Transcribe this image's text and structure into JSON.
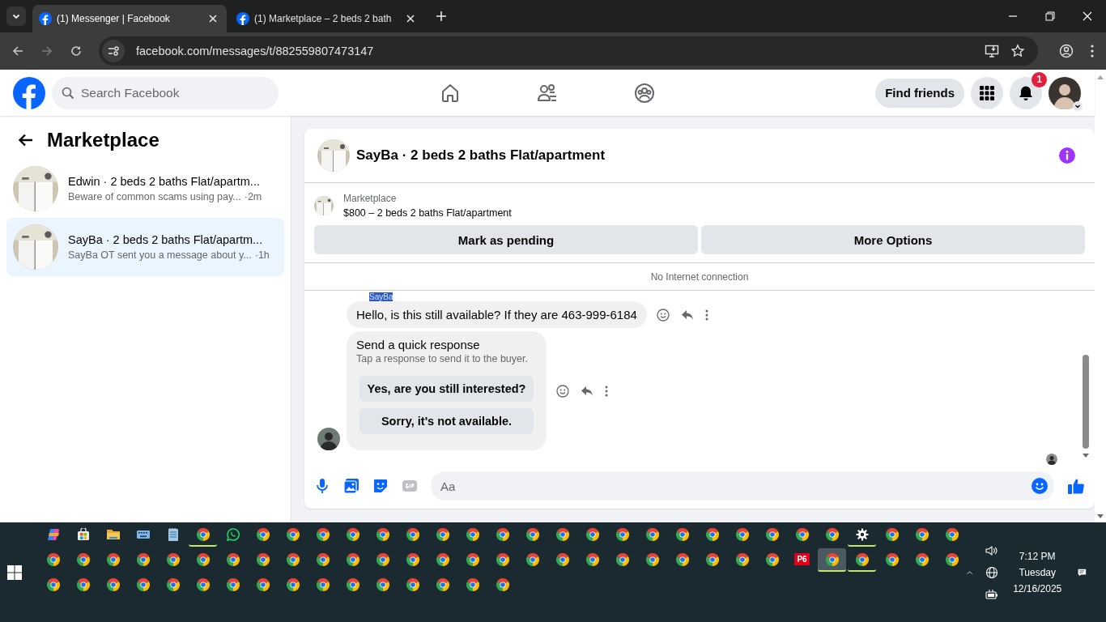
{
  "browser": {
    "tabs": [
      {
        "title": "(1) Messenger | Facebook",
        "selected": true
      },
      {
        "title": "(1) Marketplace – 2 beds 2 bath",
        "selected": false
      }
    ],
    "url": "facebook.com/messages/t/882559807473147"
  },
  "header": {
    "search": {
      "placeholder": "Search Facebook"
    },
    "find_friends": "Find friends",
    "notification_badge": "1"
  },
  "sidebar": {
    "title": "Marketplace",
    "conversations": [
      {
        "title": "Edwin · 2 beds 2 baths Flat/apartm...",
        "preview": "Beware of common scams using pay...",
        "time": "·2m",
        "selected": false
      },
      {
        "title": "SayBa · 2 beds 2 baths Flat/apartm...",
        "preview": "SayBa OT sent you a message about y...",
        "time": "·1h",
        "selected": true
      }
    ]
  },
  "chat": {
    "title": "SayBa · 2 beds 2 baths Flat/apartment",
    "listing": {
      "source": "Marketplace",
      "title": "$800 – 2 beds 2 baths Flat/apartment"
    },
    "actions": [
      "Mark as pending",
      "More Options"
    ],
    "status": "No Internet connection",
    "sender": "SayBa",
    "message": "Hello, is this still available? If they are 463-999-6184",
    "quick_response": {
      "title": "Send a quick response",
      "subtitle": "Tap a response to send it to the buyer.",
      "options": [
        "Yes, are you still interested?",
        "Sorry, it's not available."
      ]
    },
    "composer": {
      "placeholder": "Aa"
    }
  },
  "taskbar": {
    "rows": [
      [
        {
          "kind": "copilot",
          "running": false,
          "selected": false
        },
        {
          "kind": "store",
          "running": false,
          "selected": false
        },
        {
          "kind": "folder",
          "running": false,
          "selected": false
        },
        {
          "kind": "keyboard",
          "running": false,
          "selected": false
        },
        {
          "kind": "notepad",
          "running": false,
          "selected": false
        },
        {
          "kind": "chrome",
          "running": true,
          "selected": false
        },
        {
          "kind": "whatsapp",
          "running": false,
          "selected": false
        },
        {
          "kind": "chrome",
          "running": false,
          "selected": false
        },
        {
          "kind": "chrome",
          "running": false,
          "selected": false
        },
        {
          "kind": "chrome",
          "running": false,
          "selected": false
        },
        {
          "kind": "chrome",
          "running": false,
          "selected": false
        },
        {
          "kind": "chrome",
          "running": false,
          "selected": false
        },
        {
          "kind": "chrome",
          "running": false,
          "selected": false
        },
        {
          "kind": "chrome",
          "running": false,
          "selected": false
        },
        {
          "kind": "chrome",
          "running": false,
          "selected": false
        },
        {
          "kind": "chrome",
          "running": false,
          "selected": false
        },
        {
          "kind": "chrome",
          "running": false,
          "selected": false
        },
        {
          "kind": "chrome",
          "running": false,
          "selected": false
        },
        {
          "kind": "chrome",
          "running": false,
          "selected": false
        },
        {
          "kind": "chrome",
          "running": false,
          "selected": false
        },
        {
          "kind": "chrome",
          "running": false,
          "selected": false
        },
        {
          "kind": "chrome",
          "running": false,
          "selected": false
        },
        {
          "kind": "chrome",
          "running": false,
          "selected": false
        },
        {
          "kind": "chrome",
          "running": false,
          "selected": false
        },
        {
          "kind": "chrome",
          "running": false,
          "selected": false
        },
        {
          "kind": "chrome",
          "running": false,
          "selected": false
        },
        {
          "kind": "chrome",
          "running": false,
          "selected": false
        },
        {
          "kind": "settings",
          "running": true,
          "selected": false
        },
        {
          "kind": "chrome",
          "running": false,
          "selected": false
        },
        {
          "kind": "chrome",
          "running": false,
          "selected": false
        },
        {
          "kind": "chrome",
          "running": false,
          "selected": false
        }
      ],
      [
        {
          "kind": "chrome",
          "running": false,
          "selected": false
        },
        {
          "kind": "chrome",
          "running": false,
          "selected": false
        },
        {
          "kind": "chrome",
          "running": false,
          "selected": false
        },
        {
          "kind": "chrome",
          "running": false,
          "selected": false
        },
        {
          "kind": "chrome",
          "running": false,
          "selected": false
        },
        {
          "kind": "chrome",
          "running": false,
          "selected": false
        },
        {
          "kind": "chrome",
          "running": false,
          "selected": false
        },
        {
          "kind": "chrome",
          "running": false,
          "selected": false
        },
        {
          "kind": "chrome",
          "running": false,
          "selected": false
        },
        {
          "kind": "chrome",
          "running": false,
          "selected": false
        },
        {
          "kind": "chrome",
          "running": false,
          "selected": false
        },
        {
          "kind": "chrome",
          "running": false,
          "selected": false
        },
        {
          "kind": "chrome",
          "running": false,
          "selected": false
        },
        {
          "kind": "chrome",
          "running": false,
          "selected": false
        },
        {
          "kind": "chrome",
          "running": false,
          "selected": false
        },
        {
          "kind": "chrome",
          "running": false,
          "selected": false
        },
        {
          "kind": "chrome",
          "running": false,
          "selected": false
        },
        {
          "kind": "chrome",
          "running": false,
          "selected": false
        },
        {
          "kind": "chrome",
          "running": false,
          "selected": false
        },
        {
          "kind": "chrome",
          "running": false,
          "selected": false
        },
        {
          "kind": "chrome",
          "running": false,
          "selected": false
        },
        {
          "kind": "chrome",
          "running": false,
          "selected": false
        },
        {
          "kind": "chrome",
          "running": false,
          "selected": false
        },
        {
          "kind": "chrome",
          "running": false,
          "selected": false
        },
        {
          "kind": "chrome",
          "running": false,
          "selected": false
        },
        {
          "kind": "app-tile",
          "label": "P6",
          "running": false,
          "selected": false
        },
        {
          "kind": "chrome",
          "running": true,
          "selected": true
        },
        {
          "kind": "chrome",
          "running": true,
          "selected": false
        },
        {
          "kind": "chrome",
          "running": false,
          "selected": false
        },
        {
          "kind": "chrome",
          "running": false,
          "selected": false
        },
        {
          "kind": "chrome",
          "running": false,
          "selected": false
        }
      ],
      [
        {
          "kind": "chrome",
          "running": false,
          "selected": false
        },
        {
          "kind": "chrome",
          "running": false,
          "selected": false
        },
        {
          "kind": "chrome",
          "running": false,
          "selected": false
        },
        {
          "kind": "chrome",
          "running": false,
          "selected": false
        },
        {
          "kind": "chrome",
          "running": false,
          "selected": false
        },
        {
          "kind": "chrome",
          "running": false,
          "selected": false
        },
        {
          "kind": "chrome",
          "running": false,
          "selected": false
        },
        {
          "kind": "chrome",
          "running": false,
          "selected": false
        },
        {
          "kind": "chrome",
          "running": false,
          "selected": false
        },
        {
          "kind": "chrome",
          "running": false,
          "selected": false
        },
        {
          "kind": "chrome",
          "running": false,
          "selected": false
        },
        {
          "kind": "chrome",
          "running": false,
          "selected": false
        },
        {
          "kind": "chrome",
          "running": false,
          "selected": false
        },
        {
          "kind": "chrome",
          "running": false,
          "selected": false
        },
        {
          "kind": "chrome",
          "running": false,
          "selected": false
        },
        {
          "kind": "chrome",
          "running": false,
          "selected": false
        }
      ]
    ],
    "clock": {
      "time": "7:12 PM",
      "day": "Tuesday",
      "date": "12/16/2025"
    }
  }
}
